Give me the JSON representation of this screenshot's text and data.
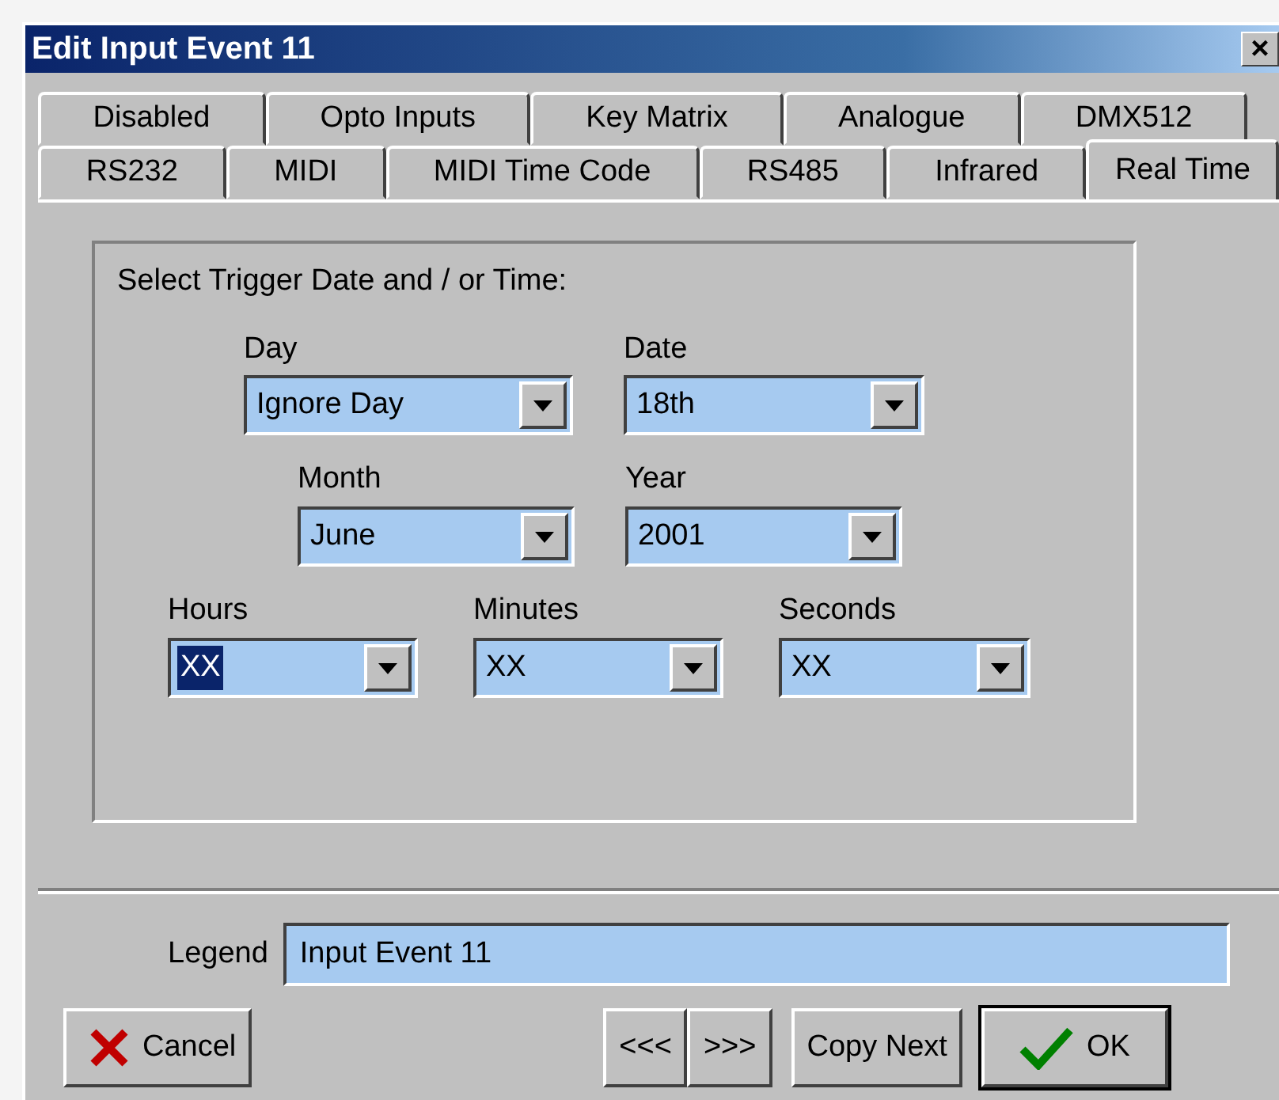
{
  "window": {
    "title": "Edit Input Event 11",
    "close": "×"
  },
  "tab_rows": [
    [
      {
        "label": "Disabled",
        "selected": false
      },
      {
        "label": "Opto Inputs",
        "selected": false
      },
      {
        "label": "Key Matrix",
        "selected": false
      },
      {
        "label": "Analogue",
        "selected": false
      },
      {
        "label": "DMX512",
        "selected": false
      }
    ],
    [
      {
        "label": "RS232",
        "selected": false
      },
      {
        "label": "MIDI",
        "selected": false
      },
      {
        "label": "MIDI Time Code",
        "selected": false
      },
      {
        "label": "RS485",
        "selected": false
      },
      {
        "label": "Infrared",
        "selected": false
      },
      {
        "label": "Real Time",
        "selected": true
      }
    ]
  ],
  "group": {
    "caption": "Select Trigger Date and / or Time:",
    "combo_rows": [
      [
        {
          "label": "Day",
          "value": "Ignore Day",
          "highlighted": false
        },
        {
          "label": "Date",
          "value": "18th",
          "highlighted": false
        }
      ],
      [
        {
          "label": "Month",
          "value": "June",
          "highlighted": false
        },
        {
          "label": "Year",
          "value": "2001",
          "highlighted": false
        }
      ],
      [
        {
          "label": "Hours",
          "value": "XX",
          "highlighted": true
        },
        {
          "label": "Minutes",
          "value": "XX",
          "highlighted": false
        },
        {
          "label": "Seconds",
          "value": "XX",
          "highlighted": false
        }
      ]
    ]
  },
  "legend": {
    "label": "Legend",
    "value": "Input Event 11"
  },
  "buttons": [
    {
      "kind": "cancel",
      "label": "Cancel"
    },
    {
      "kind": "prev",
      "label": "<<<"
    },
    {
      "kind": "next",
      "label": ">>>"
    },
    {
      "kind": "copy",
      "label": "Copy Next"
    },
    {
      "kind": "ok",
      "label": "OK"
    }
  ]
}
